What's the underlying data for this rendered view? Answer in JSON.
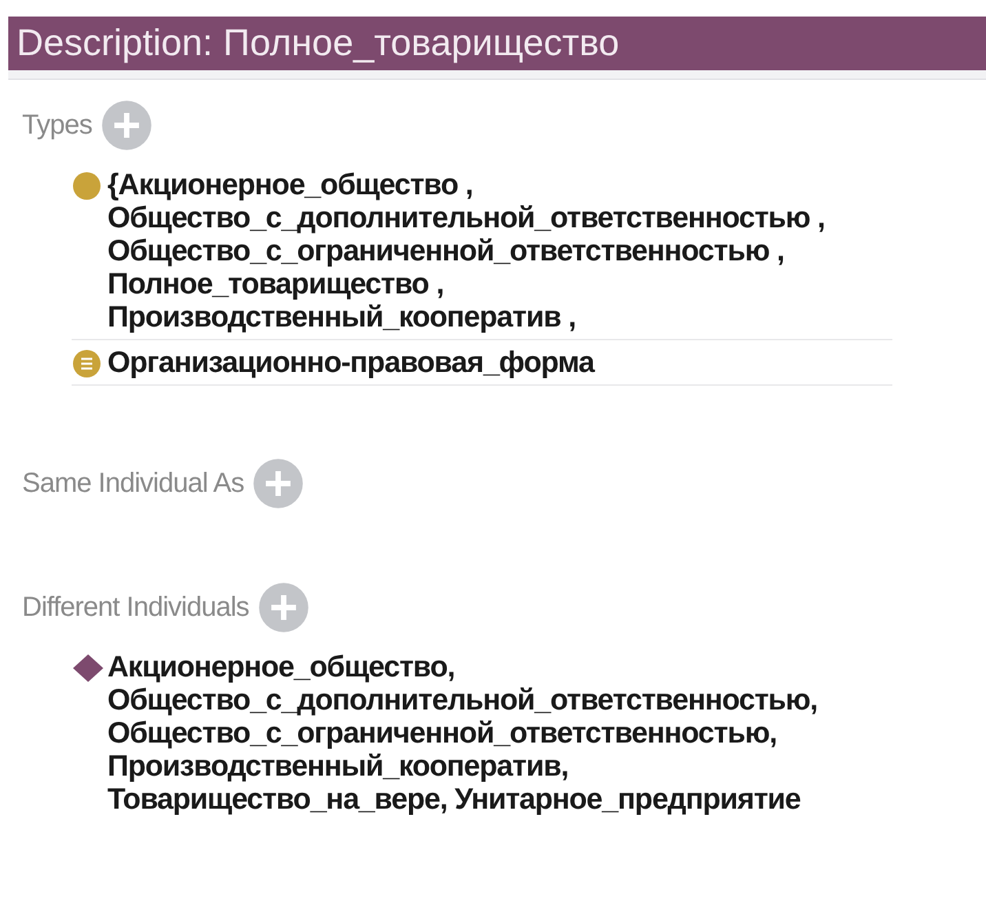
{
  "header": {
    "title": "Description: Полное_товарищество"
  },
  "sections": [
    {
      "title": "Types",
      "items": [
        {
          "kind": "class-expression",
          "lines": [
            "{Акционерное_общество ,",
            "Общество_с_дополнительной_ответственностью ,",
            "Общество_с_ограниченной_ответственностью ,",
            "Полное_товарищество ,",
            "Производственный_кооператив ,"
          ]
        },
        {
          "kind": "class",
          "lines": [
            "Организационно-правовая_форма"
          ]
        }
      ]
    },
    {
      "title": "Same Individual As"
    },
    {
      "title": "Different Individuals",
      "items": [
        {
          "kind": "individual",
          "lines": [
            "Акционерное_общество,",
            "Общество_с_дополнительной_ответственностью,",
            "Общество_с_ограниченной_ответственностью,",
            "Производственный_кооператив,",
            "Товарищество_на_вере, Унитарное_предприятие"
          ]
        }
      ]
    }
  ]
}
